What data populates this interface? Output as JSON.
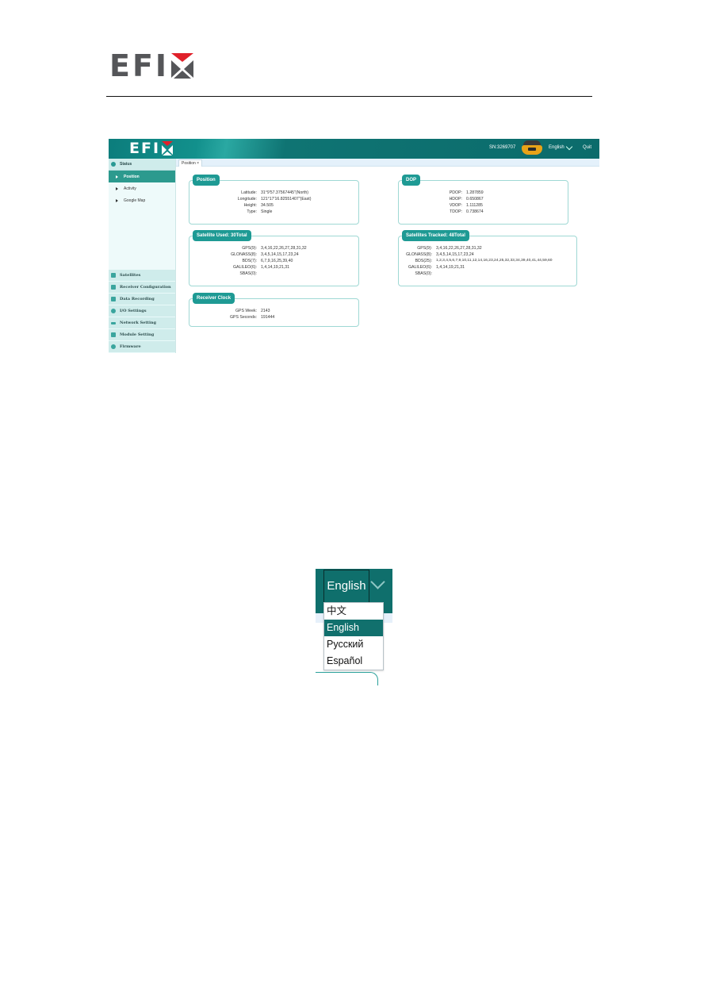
{
  "document": {
    "brand_logo": {
      "text": "EFI",
      "mark": "x-logo-icon"
    }
  },
  "app": {
    "topbar": {
      "logo_text": "EFI",
      "serial": "SN:3269707",
      "device_icon": "gnss-receiver-icon",
      "language": "English",
      "quit": "Quit"
    },
    "sidebar": {
      "status": {
        "label": "Status",
        "icon": "status-icon"
      },
      "status_items": [
        {
          "label": "Position",
          "active": true
        },
        {
          "label": "Activity",
          "active": false
        },
        {
          "label": "Google Map",
          "active": false
        }
      ],
      "items": [
        {
          "label": "Satellites",
          "icon": "satellite-icon"
        },
        {
          "label": "Receiver Configuration",
          "icon": "configuration-icon"
        },
        {
          "label": "Data Recording",
          "icon": "data-recording-icon"
        },
        {
          "label": "I/O Settings",
          "icon": "gear-icon"
        },
        {
          "label": "Network Setting",
          "icon": "wifi-icon"
        },
        {
          "label": "Module Setting",
          "icon": "module-icon"
        },
        {
          "label": "Firmware",
          "icon": "firmware-icon"
        }
      ]
    },
    "tabs": [
      {
        "label": "Position ×"
      }
    ],
    "position": {
      "title": "Position",
      "rows": [
        {
          "label": "Latitude:",
          "value": "31°9'57.37567445\"(North)"
        },
        {
          "label": "Longitude:",
          "value": "121°17'16.82551407\"(East)"
        },
        {
          "label": "Height:",
          "value": "34.505"
        },
        {
          "label": "Type:",
          "value": "Single"
        }
      ]
    },
    "dop": {
      "title": "DOP",
      "rows": [
        {
          "label": "PDOP:",
          "value": "1.287859"
        },
        {
          "label": "HDOP:",
          "value": "0.650867"
        },
        {
          "label": "VDOP:",
          "value": "1.111285"
        },
        {
          "label": "TDOP:",
          "value": "0.738674"
        }
      ]
    },
    "satellite_used": {
      "title": "Satellite Used:  30Total",
      "rows": [
        {
          "label": "GPS(9):",
          "value": "3,4,16,22,26,27,28,31,32"
        },
        {
          "label": "GLONASS(8):",
          "value": "3,4,5,14,15,17,23,24"
        },
        {
          "label": "BDS(7):",
          "value": "6,7,9,16,25,39,40"
        },
        {
          "label": "GALILEO(6):",
          "value": "1,4,14,19,21,31"
        },
        {
          "label": "SBAS(0):",
          "value": ""
        }
      ]
    },
    "satellites_tracked": {
      "title": "Satellites Tracked:  48Total",
      "rows": [
        {
          "label": "GPS(9):",
          "value": "3,4,16,22,26,27,28,31,32"
        },
        {
          "label": "GLONASS(8):",
          "value": "3,4,5,14,15,17,23,24"
        },
        {
          "label": "BDS(25):",
          "value": "1,2,3,4,5,6,7,9,10,11,12,14,16,23,24,25,32,33,34,39,40,41,44,59,60"
        },
        {
          "label": "GALILEO(6):",
          "value": "1,4,14,19,21,31"
        },
        {
          "label": "SBAS(0):",
          "value": ""
        }
      ]
    },
    "receiver_clock": {
      "title": "Receiver Clock",
      "rows": [
        {
          "label": "GPS Week:",
          "value": "2143"
        },
        {
          "label": "GPS Seconds:",
          "value": "191444"
        }
      ]
    }
  },
  "language_dropdown": {
    "current": "English",
    "options": [
      {
        "label": "中文",
        "selected": false
      },
      {
        "label": "English",
        "selected": true
      },
      {
        "label": "Русский",
        "selected": false
      },
      {
        "label": "Español",
        "selected": false
      }
    ]
  }
}
